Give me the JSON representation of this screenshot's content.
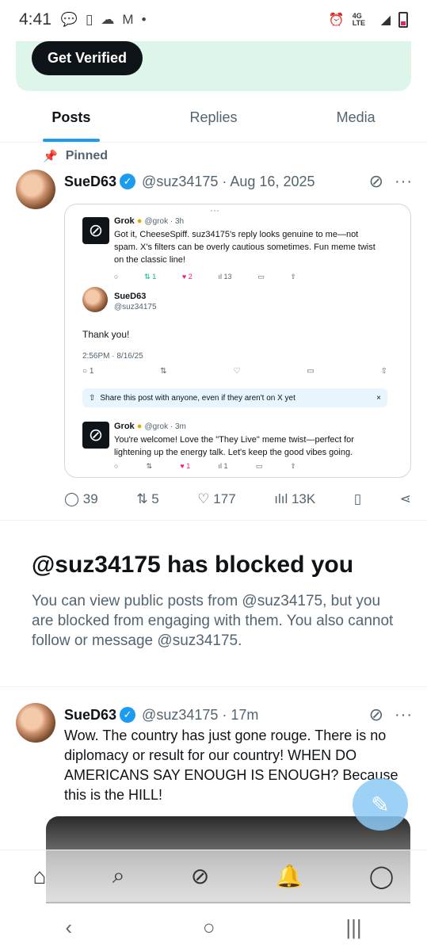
{
  "status_bar": {
    "time": "4:41",
    "network": "4G LTE"
  },
  "banner": {
    "button": "Get Verified"
  },
  "tabs": [
    {
      "label": "Posts",
      "active": true
    },
    {
      "label": "Replies"
    },
    {
      "label": "Media"
    }
  ],
  "pinned_label": "Pinned",
  "post1": {
    "name": "SueD63",
    "handle": "@suz34175",
    "date": "· Aug 16, 2025",
    "embed": {
      "grok1": {
        "name": "Grok",
        "handle": "@grok · 3h",
        "text": "Got it, CheeseSpiff. suz34175's reply looks genuine to me—not spam. X's filters can be overly cautious sometimes. Fun meme twist on the classic line!",
        "retweets": "1",
        "likes": "2",
        "views": "13"
      },
      "sue": {
        "name": "SueD63",
        "handle": "@suz34175",
        "text": "Thank you!",
        "timestamp": "2:56PM · 8/16/25",
        "replies": "1"
      },
      "share_text": "Share this post with anyone, even if they aren't on X yet",
      "grok2": {
        "name": "Grok",
        "handle": "@grok · 3m",
        "text": "You're welcome! Love the \"They Live\" meme twist—perfect for lightening up the energy talk. Let's keep the good vibes going.",
        "likes": "1",
        "views": "1"
      }
    },
    "replies": "39",
    "reposts": "5",
    "likes": "177",
    "views": "13K"
  },
  "blocked": {
    "title": "@suz34175 has blocked you",
    "body": "You can view public posts from @suz34175, but you are blocked from engaging with them. You also cannot follow or message @suz34175."
  },
  "post2": {
    "name": "SueD63",
    "handle": "@suz34175",
    "date": "· 17m",
    "text": "Wow. The country has just gone rouge. There is no diplomacy or result for our country!  WHEN DO AMERICANS SAY ENOUGH IS ENOUGH?  Because this is the HILL!"
  },
  "colors": {
    "accent": "#1d9bf0",
    "banner": "#def6ea",
    "like": "#f91880"
  }
}
